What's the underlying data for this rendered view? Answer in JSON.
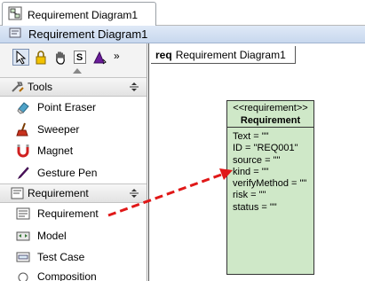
{
  "tab": {
    "label": "Requirement Diagram1"
  },
  "titlebar": {
    "label": "Requirement Diagram1"
  },
  "palette": {
    "toolbar": {
      "s_label": "S",
      "more_label": "»"
    },
    "tools_group": {
      "label": "Tools",
      "items": [
        {
          "label": "Point Eraser",
          "icon": "eraser-icon"
        },
        {
          "label": "Sweeper",
          "icon": "sweeper-icon"
        },
        {
          "label": "Magnet",
          "icon": "magnet-icon"
        },
        {
          "label": "Gesture Pen",
          "icon": "pen-icon"
        }
      ]
    },
    "requirement_group": {
      "label": "Requirement",
      "items": [
        {
          "label": "Requirement",
          "icon": "requirement-icon"
        },
        {
          "label": "Model",
          "icon": "model-icon"
        },
        {
          "label": "Test Case",
          "icon": "test-case-icon"
        },
        {
          "label": "Composition",
          "icon": "composition-icon"
        }
      ]
    }
  },
  "canvas": {
    "frame_keyword": "req",
    "frame_name": "Requirement Diagram1",
    "requirement": {
      "stereotype": "<<requirement>>",
      "name": "Requirement",
      "attributes": [
        "Text = \"\"",
        "ID = \"REQ001\"",
        "source = \"\"",
        "kind = \"\"",
        "verifyMethod = \"\"",
        "risk = \"\"",
        "status = \"\""
      ]
    }
  },
  "colors": {
    "requirement_fill": "#cfe8c8",
    "arrow": "#e01818",
    "titlebar": "#c8d8ee"
  }
}
